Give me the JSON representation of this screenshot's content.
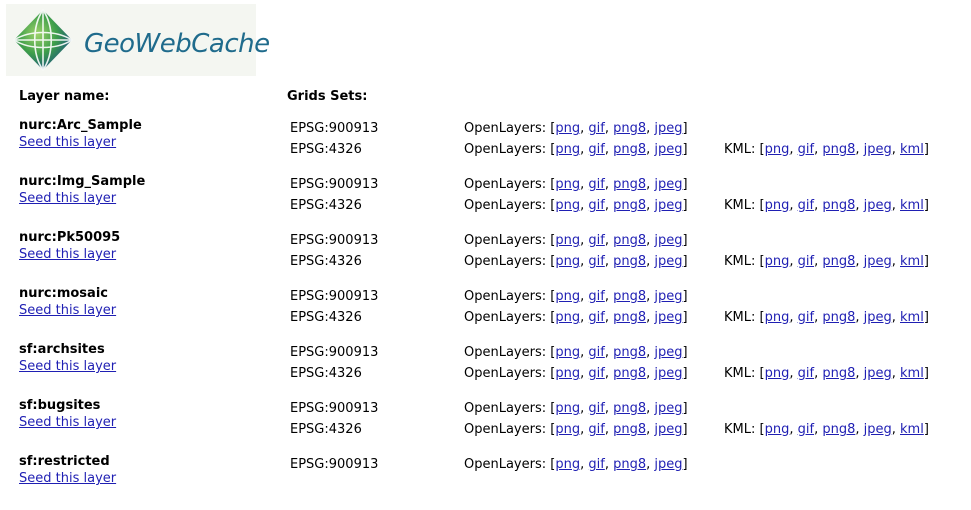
{
  "header": {
    "logo_text": "GeoWebCache",
    "layer_name_label": "Layer name:",
    "grid_sets_label": "Grids Sets:"
  },
  "seed_label": "Seed this layer",
  "openlayers_label": "OpenLayers:",
  "kml_label": "KML:",
  "formats_openlayers": [
    "png",
    "gif",
    "png8",
    "jpeg"
  ],
  "formats_kml": [
    "png",
    "gif",
    "png8",
    "jpeg",
    "kml"
  ],
  "layers": [
    {
      "name": "nurc:Arc_Sample",
      "grids": [
        "EPSG:900913",
        "EPSG:4326"
      ]
    },
    {
      "name": "nurc:Img_Sample",
      "grids": [
        "EPSG:900913",
        "EPSG:4326"
      ]
    },
    {
      "name": "nurc:Pk50095",
      "grids": [
        "EPSG:900913",
        "EPSG:4326"
      ]
    },
    {
      "name": "nurc:mosaic",
      "grids": [
        "EPSG:900913",
        "EPSG:4326"
      ]
    },
    {
      "name": "sf:archsites",
      "grids": [
        "EPSG:900913",
        "EPSG:4326"
      ]
    },
    {
      "name": "sf:bugsites",
      "grids": [
        "EPSG:900913",
        "EPSG:4326"
      ]
    },
    {
      "name": "sf:restricted",
      "grids": [
        "EPSG:900913"
      ]
    }
  ],
  "colors": {
    "link": "#1f1fb3",
    "logo_text": "#1f6b8c"
  },
  "icons": {
    "logo": "globe-grid-icon"
  }
}
